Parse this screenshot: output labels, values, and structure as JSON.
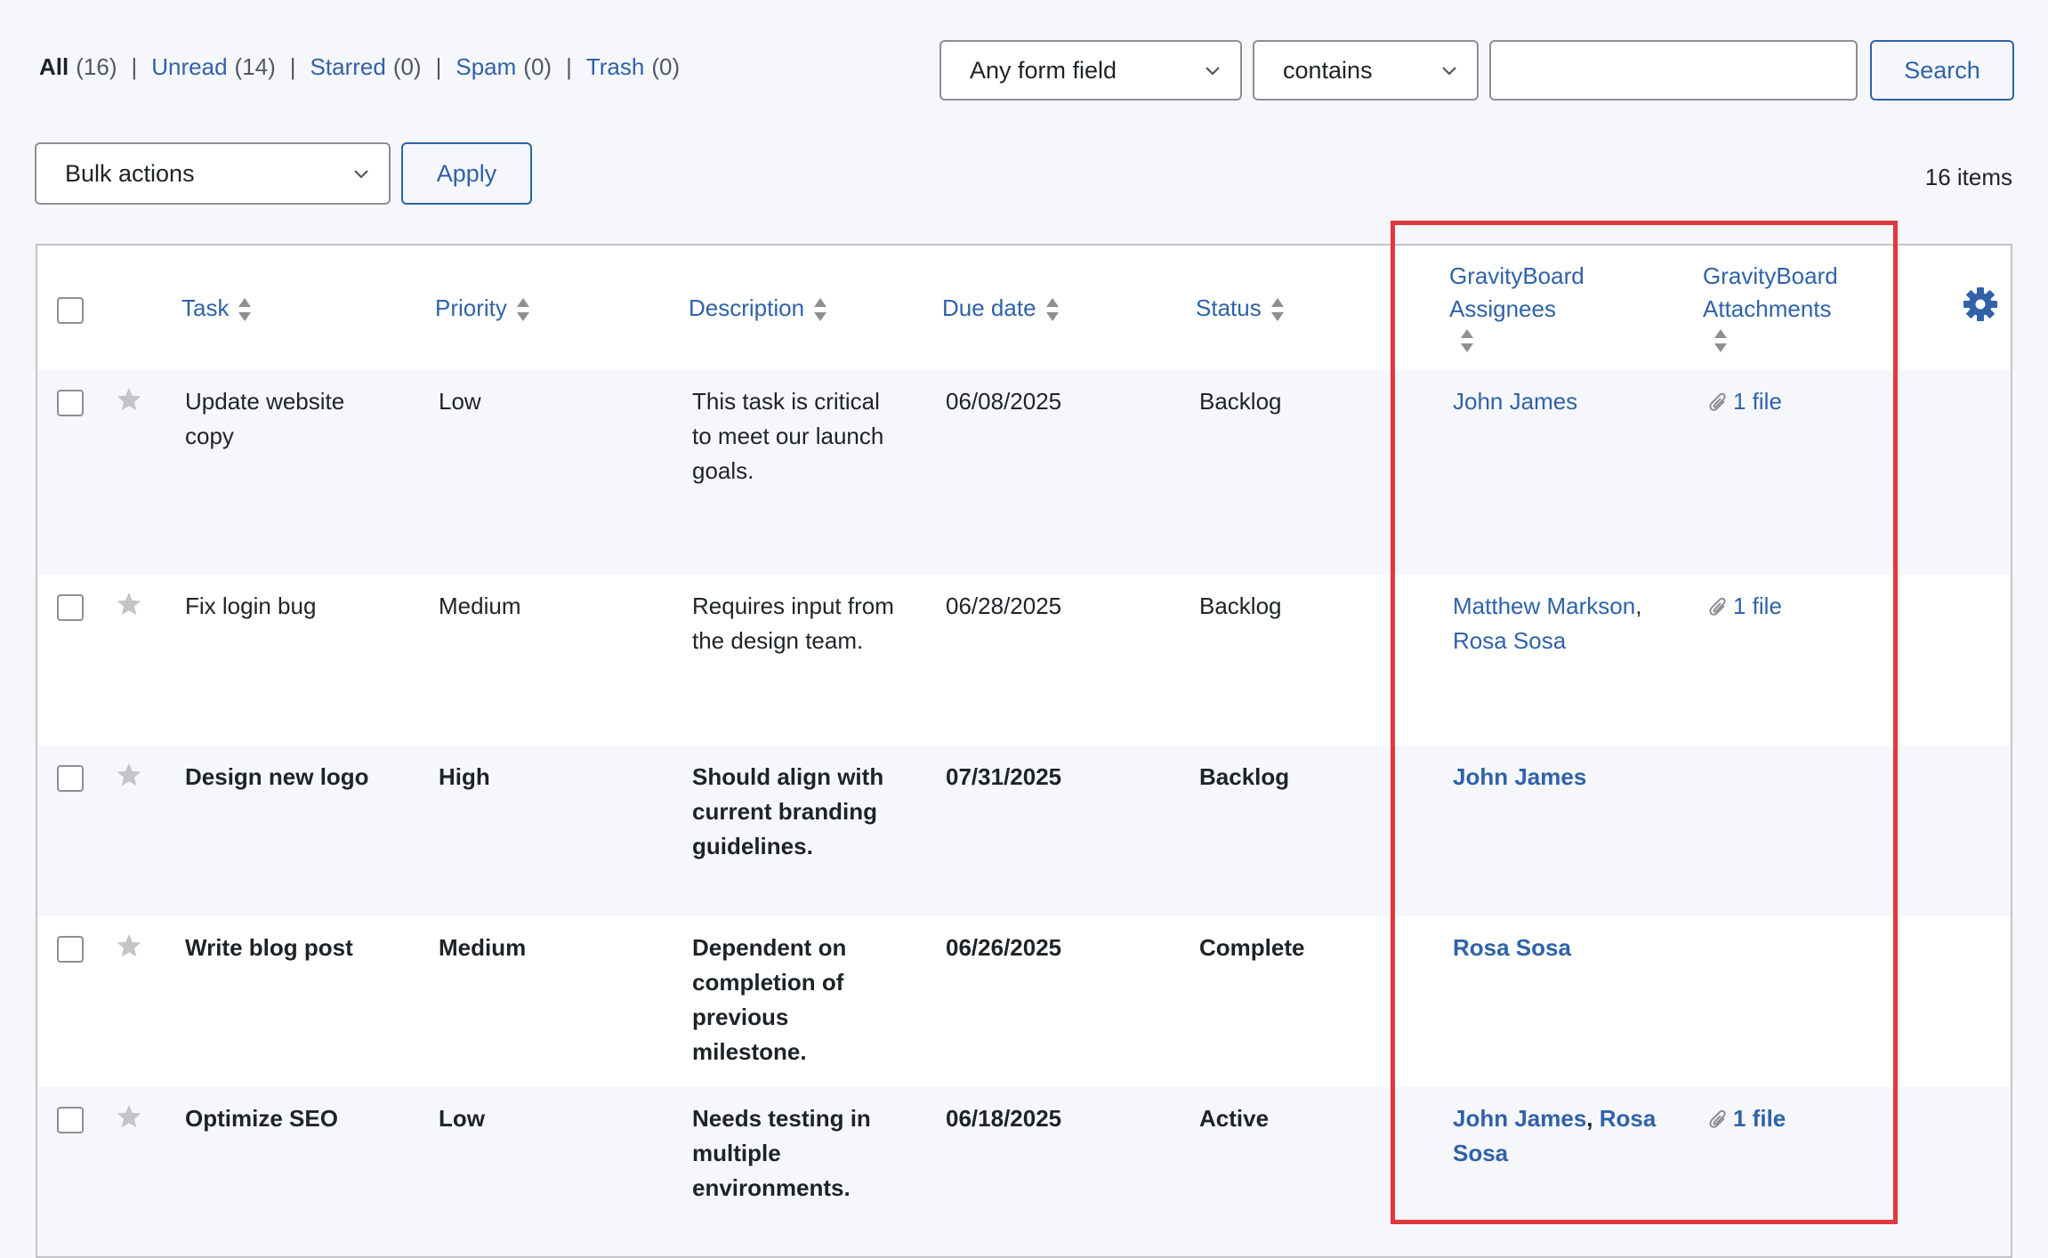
{
  "filters": [
    {
      "label": "All",
      "count": "(16)"
    },
    {
      "label": "Unread",
      "count": "(14)"
    },
    {
      "label": "Starred",
      "count": "(0)"
    },
    {
      "label": "Spam",
      "count": "(0)"
    },
    {
      "label": "Trash",
      "count": "(0)"
    }
  ],
  "filter_separator": "|",
  "search": {
    "field": "Any form field",
    "operator": "contains",
    "value": "",
    "button": "Search"
  },
  "bulk": {
    "select": "Bulk actions",
    "apply": "Apply"
  },
  "items_count": "16 items",
  "columns": {
    "task": "Task",
    "priority": "Priority",
    "description": "Description",
    "due_date": "Due date",
    "status": "Status",
    "assignees_l1": "GravityBoard",
    "assignees_l2": "Assignees",
    "attachments_l1": "GravityBoard",
    "attachments_l2": "Attachments"
  },
  "rows": [
    {
      "task_l1": "Update website",
      "task_l2": "copy",
      "priority": "Low",
      "desc": [
        "This task is critical",
        "to meet our launch",
        "goals."
      ],
      "due": "06/08/2025",
      "status": "Backlog",
      "assignee_a": "John James",
      "assignee_sep": "",
      "assignee_b": "",
      "assignee_c": "",
      "attachments": "1 file"
    },
    {
      "task_l1": "Fix login bug",
      "task_l2": "",
      "priority": "Medium",
      "desc": [
        "Requires input from",
        "the design team."
      ],
      "due": "06/28/2025",
      "status": "Backlog",
      "assignee_a": "Matthew Markson",
      "assignee_sep": ",",
      "assignee_b": "",
      "assignee_c": "Rosa Sosa",
      "attachments": "1 file"
    },
    {
      "task_l1": "Design new logo",
      "task_l2": "",
      "priority": "High",
      "desc": [
        "Should align with",
        "current branding",
        "guidelines."
      ],
      "due": "07/31/2025",
      "status": "Backlog",
      "assignee_a": "John James",
      "assignee_sep": "",
      "assignee_b": "",
      "assignee_c": "",
      "attachments": ""
    },
    {
      "task_l1": "Write blog post",
      "task_l2": "",
      "priority": "Medium",
      "desc": [
        "Dependent on",
        "completion of",
        "previous",
        "milestone."
      ],
      "due": "06/26/2025",
      "status": "Complete",
      "assignee_a": "Rosa Sosa",
      "assignee_sep": "",
      "assignee_b": "",
      "assignee_c": "",
      "attachments": ""
    },
    {
      "task_l1": "Optimize SEO",
      "task_l2": "",
      "priority": "Low",
      "desc": [
        "Needs testing in",
        "multiple",
        "environments."
      ],
      "due": "06/18/2025",
      "status": "Active",
      "assignee_a": "John James",
      "assignee_sep": ",",
      "assignee_b": "Rosa",
      "assignee_c": "Sosa",
      "attachments": "1 file"
    }
  ],
  "colors": {
    "link": "#2f62a8",
    "highlight": "#e0383e",
    "row_alt": "#f6f7fb"
  },
  "icons": {
    "sort": "sort-arrows-icon",
    "star": "star-icon",
    "gear": "gear-icon",
    "attachment": "paperclip-icon",
    "dropdown": "chevron-down-icon"
  }
}
